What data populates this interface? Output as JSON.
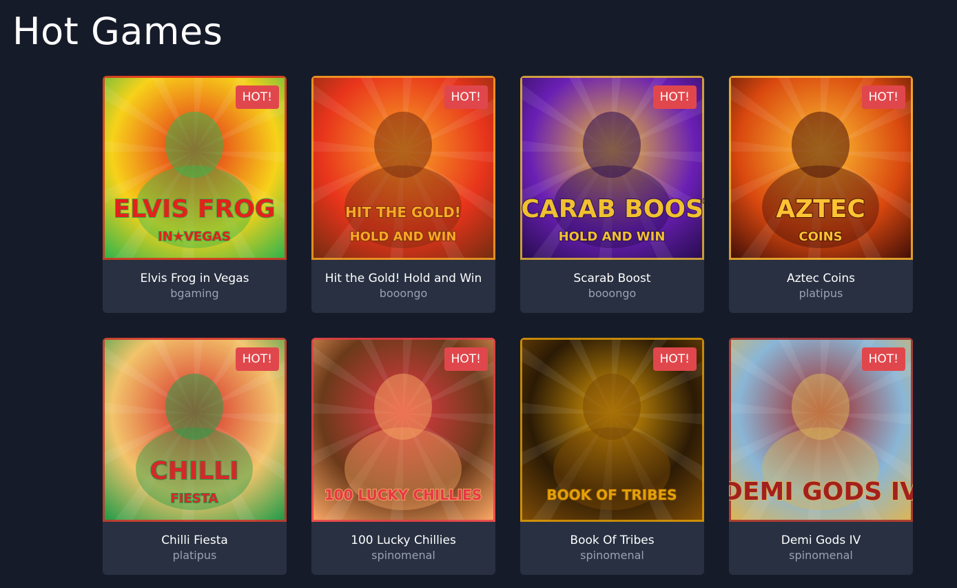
{
  "section": {
    "title": "Hot Games"
  },
  "colors": {
    "background": "#161b29",
    "card": "#283041",
    "badge": "#e0474c",
    "provider_text": "#9aa3b2"
  },
  "games": [
    {
      "name": "Elvis Frog in Vegas",
      "provider": "bgaming",
      "badge": "HOT!",
      "art_text": [
        "ELVIS FROG",
        "IN★VEGAS"
      ],
      "palette": [
        "#f7d21a",
        "#e2231a",
        "#39b54a"
      ]
    },
    {
      "name": "Hit the Gold! Hold and Win",
      "provider": "booongo",
      "badge": "HOT!",
      "art_text": [
        "HIT THE GOLD!",
        "HOLD AND WIN"
      ],
      "palette": [
        "#e8341c",
        "#f9a825",
        "#7a2d10"
      ]
    },
    {
      "name": "Scarab Boost",
      "provider": "booongo",
      "badge": "HOT!",
      "art_text": [
        "SCARAB BOOST",
        "HOLD AND WIN"
      ],
      "palette": [
        "#6a1fb4",
        "#f0c030",
        "#2b0d55"
      ]
    },
    {
      "name": "Aztec Coins",
      "provider": "platipus",
      "badge": "HOT!",
      "art_text": [
        "AZTEC",
        "COINS"
      ],
      "palette": [
        "#d9480f",
        "#ffc233",
        "#4a1208"
      ]
    },
    {
      "name": "Chilli Fiesta",
      "provider": "platipus",
      "badge": "HOT!",
      "art_text": [
        "CHILLI",
        "FIESTA"
      ],
      "palette": [
        "#f2c46b",
        "#d62828",
        "#2a9d4a"
      ]
    },
    {
      "name": "100 Lucky Chillies",
      "provider": "spinomenal",
      "badge": "HOT!",
      "art_text": [
        "100 LUCKY CHILLIES"
      ],
      "palette": [
        "#6b3a1a",
        "#e63946",
        "#f4a261"
      ]
    },
    {
      "name": "Book Of Tribes",
      "provider": "spinomenal",
      "badge": "HOT!",
      "art_text": [
        "BOOK OF TRIBES"
      ],
      "palette": [
        "#2b1a05",
        "#e3a008",
        "#7a4a06"
      ]
    },
    {
      "name": "Demi Gods IV",
      "provider": "spinomenal",
      "badge": "HOT!",
      "art_text": [
        "DEMI GODS IV"
      ],
      "palette": [
        "#8ab6d6",
        "#a3201f",
        "#d8b55c"
      ]
    }
  ]
}
